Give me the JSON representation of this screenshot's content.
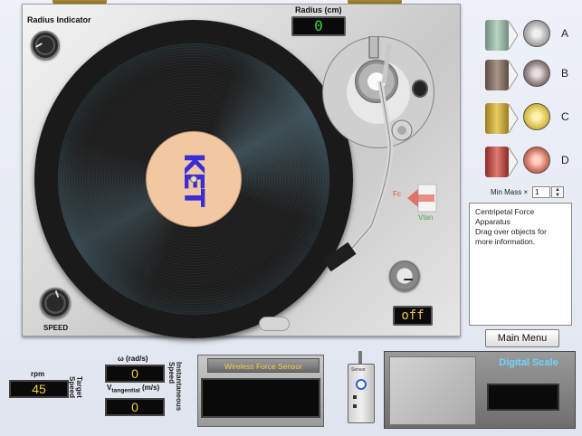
{
  "radius_indicator": {
    "label": "Radius Indicator"
  },
  "radius": {
    "label": "Radius (cm)",
    "value": "0"
  },
  "record_label": {
    "text": "KET"
  },
  "speed": {
    "label": "SPEED"
  },
  "power": {
    "state": "off"
  },
  "force_arrow": {
    "f_label": "Fc",
    "v_label": "Vtan"
  },
  "objects": [
    {
      "letter": "A",
      "color": "#9db8a8",
      "puck": "#c4c4c4"
    },
    {
      "letter": "B",
      "color": "#8a7466",
      "puck": "#8e7e80"
    },
    {
      "letter": "C",
      "color": "#c8a83c",
      "puck": "#d8c04c"
    },
    {
      "letter": "D",
      "color": "#b8463e",
      "puck": "#d07060"
    }
  ],
  "min_mass": {
    "label": "Min Mass ×",
    "value": "1"
  },
  "info": {
    "line1": "Centripetal Force",
    "line2": "Apparatus",
    "line3": "Drag over objects for",
    "line4": "more information."
  },
  "main_menu": {
    "label": "Main Menu"
  },
  "rpm": {
    "label": "rpm",
    "value": "45",
    "side_label1": "Target",
    "side_label2": "Speed"
  },
  "omega": {
    "label": "ω (rad/s)",
    "value": "0"
  },
  "vtan": {
    "label_main": "V",
    "label_sub": "tangential",
    "label_unit": " (m/s)",
    "value": "0"
  },
  "inst_speed": {
    "side_label1": "Instantaneous",
    "side_label2": "Speed"
  },
  "force_sensor": {
    "title": "Wireless Force Sensor",
    "device_label": "Sensor"
  },
  "scale": {
    "title": "Digital Scale"
  }
}
